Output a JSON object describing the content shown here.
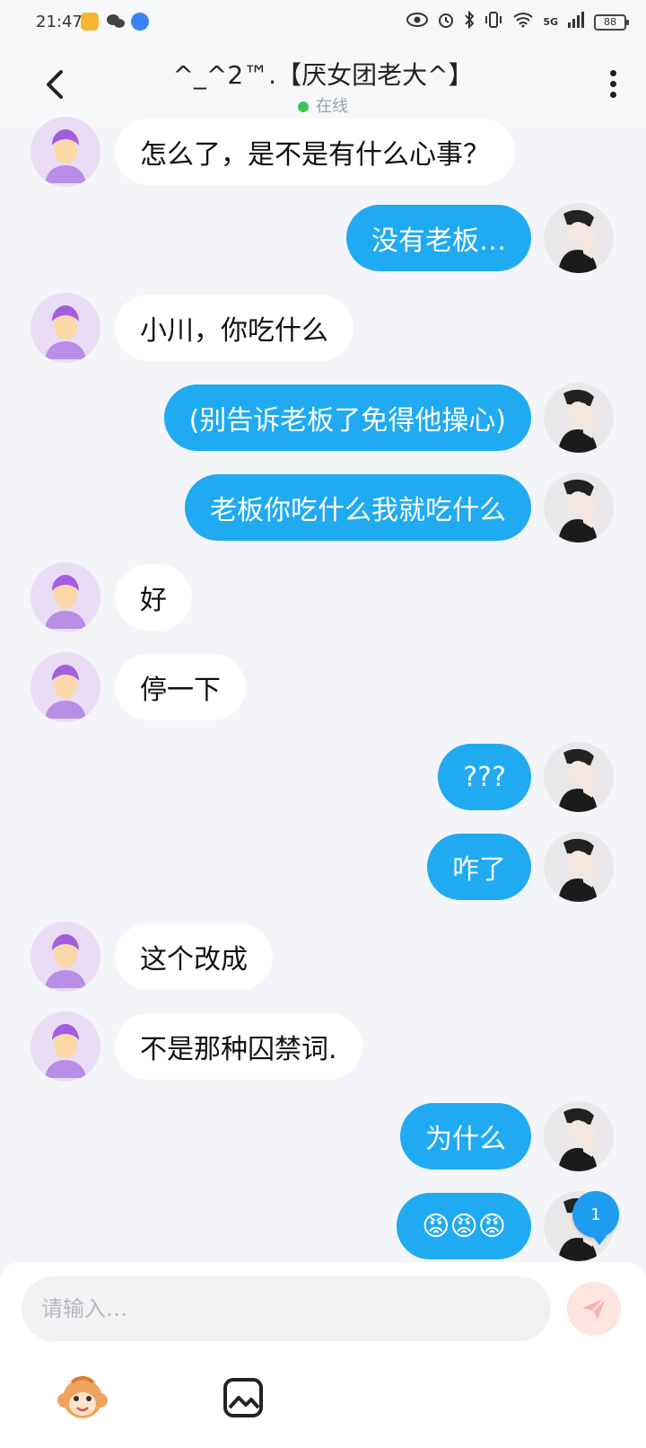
{
  "status_bar": {
    "time": "21:47",
    "network": "5G",
    "battery": "88"
  },
  "header": {
    "title": "^_^2™.【厌女团老大^】",
    "presence": "在线"
  },
  "messages": [
    {
      "side": "them",
      "text": "怎么了，是不是有什么心事？"
    },
    {
      "side": "me",
      "text": "没有老板…"
    },
    {
      "side": "them",
      "text": "小川，你吃什么"
    },
    {
      "side": "me",
      "text": "(别告诉老板了免得他操心)"
    },
    {
      "side": "me",
      "text": "老板你吃什么我就吃什么"
    },
    {
      "side": "them",
      "text": "好"
    },
    {
      "side": "them",
      "text": "停一下"
    },
    {
      "side": "me",
      "text": "???"
    },
    {
      "side": "me",
      "text": "咋了"
    },
    {
      "side": "them",
      "text": "这个改成"
    },
    {
      "side": "them",
      "text": "不是那种囚禁词."
    },
    {
      "side": "me",
      "text": "为什么"
    },
    {
      "side": "me",
      "text": "😡😡😡"
    }
  ],
  "unread_badge": "1",
  "composer": {
    "placeholder": "请输入…"
  },
  "colors": {
    "my_bubble": "#1faaf2",
    "their_bubble": "#ffffff",
    "online": "#3cc45b"
  }
}
